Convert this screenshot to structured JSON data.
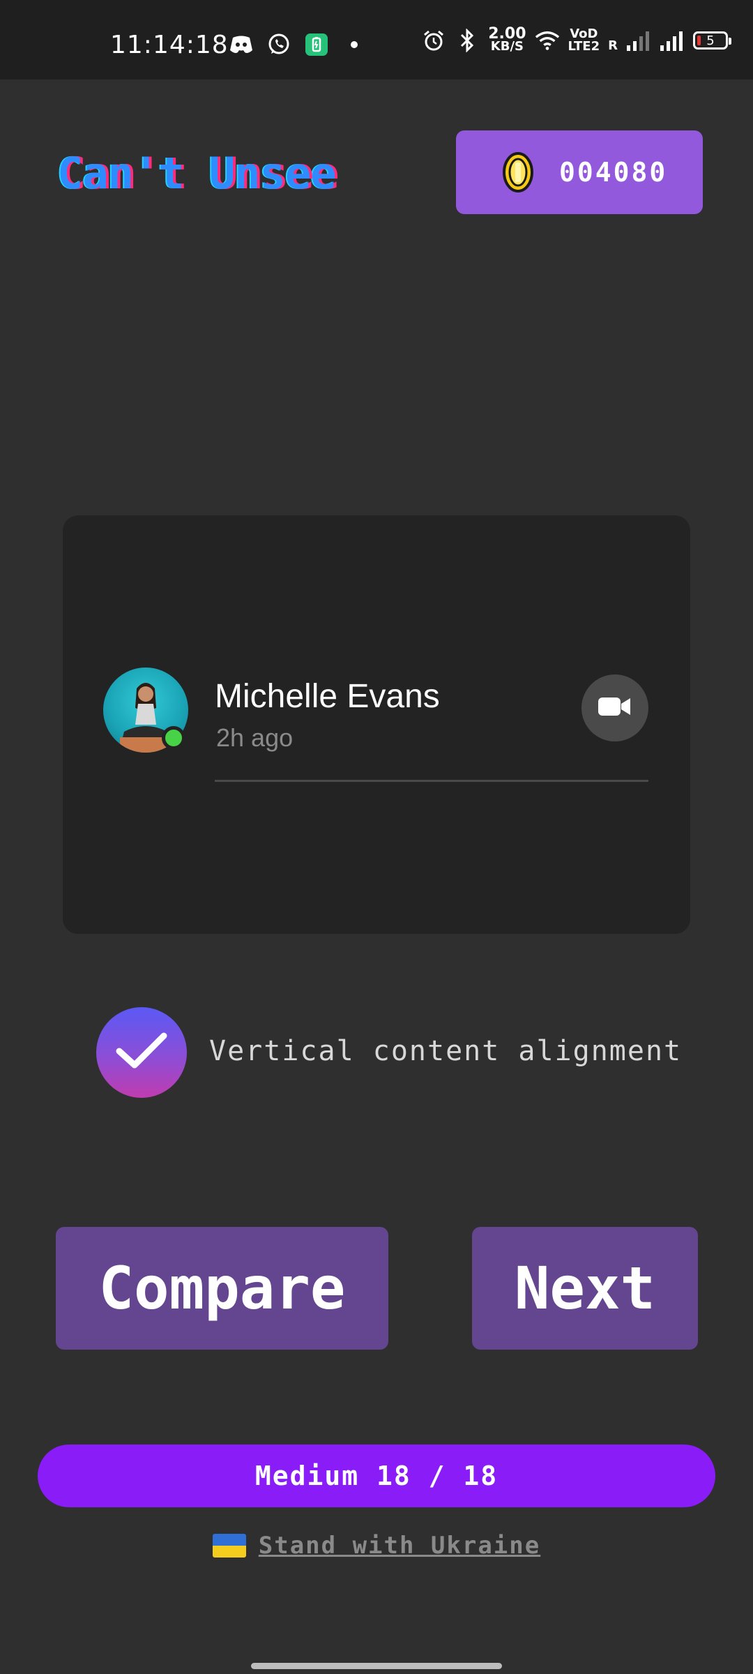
{
  "status_bar": {
    "time": "11:14:18",
    "speed_value": "2.00",
    "speed_unit": "KB/S",
    "volte_label_top": "VoD",
    "volte_label_bottom": "LTE2",
    "roaming": "R",
    "battery_level": "5",
    "icons_left": [
      "discord-icon",
      "whatsapp-icon",
      "battery-saver-icon",
      "dot-icon"
    ],
    "icons_right": [
      "alarm-icon",
      "bluetooth-icon",
      "wifi-icon",
      "signal-icon",
      "signal-icon",
      "battery-icon"
    ]
  },
  "header": {
    "logo": "Can't Unsee",
    "coins": "004080"
  },
  "preview": {
    "contact_name": "Michelle Evans",
    "contact_time": "2h ago",
    "status_color": "#47d247"
  },
  "option": {
    "label": "Vertical content alignment",
    "checked": true
  },
  "actions": {
    "compare_label": "Compare",
    "next_label": "Next"
  },
  "level": {
    "text": "Medium 18 / 18"
  },
  "footer": {
    "link_text": "Stand with Ukraine"
  },
  "colors": {
    "background": "#2f2f2f",
    "accent_purple": "#8a1cf7",
    "button_purple": "#63468f",
    "coin_box": "#9359dc"
  }
}
